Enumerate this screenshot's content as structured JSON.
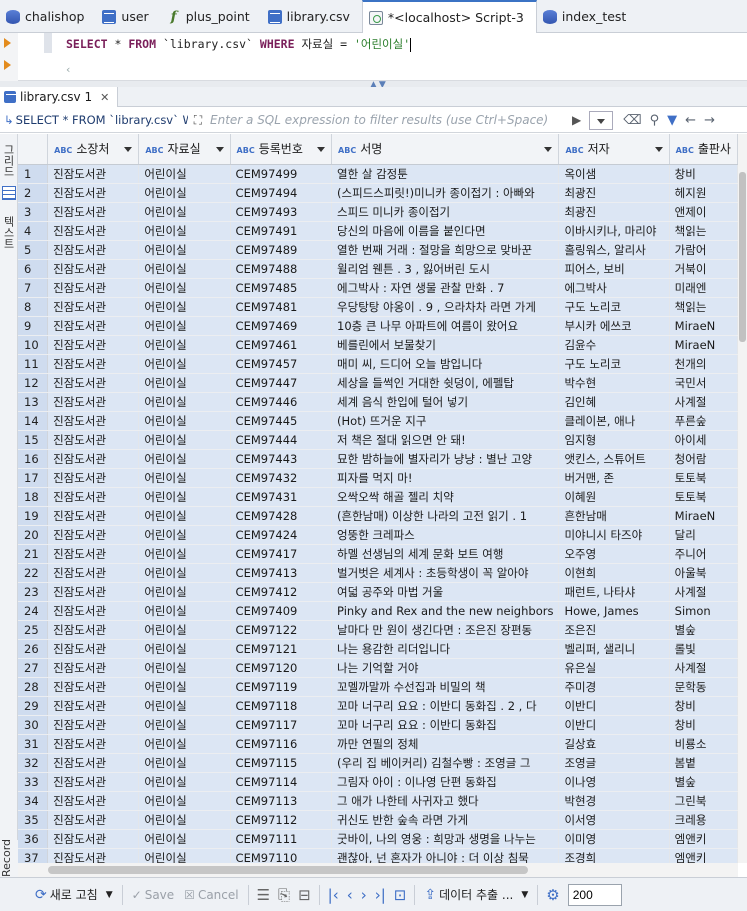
{
  "tabs": [
    {
      "label": "chalishop",
      "icon": "database-icon",
      "active": false
    },
    {
      "label": "user",
      "icon": "table-icon",
      "active": false
    },
    {
      "label": "plus_point",
      "icon": "function-icon",
      "active": false
    },
    {
      "label": "library.csv",
      "icon": "table-icon",
      "active": false
    },
    {
      "label": "*<localhost> Script-3",
      "icon": "script-icon",
      "active": true
    },
    {
      "label": "index_test",
      "icon": "database-icon",
      "active": false
    }
  ],
  "editor": {
    "kw_select": "SELECT",
    "star": " * ",
    "kw_from": "FROM",
    "table": " `library.csv` ",
    "kw_where": "WHERE",
    "column": " 자료실 = ",
    "value": "'어린이실'"
  },
  "results_tab": {
    "label": "library.csv 1",
    "close": "✕"
  },
  "filter": {
    "query": "SELECT * FROM `library.csv` WH",
    "placeholder": "Enter a SQL expression to filter results (use Ctrl+Space)"
  },
  "side": {
    "grid_label": "그리드",
    "text_label": "텍스트",
    "record_label": "Record"
  },
  "columns": [
    "소장처",
    "자료실",
    "등록번호",
    "서명",
    "저자",
    "출판사"
  ],
  "rows": [
    [
      "1",
      "진잠도서관",
      "어린이실",
      "CEM97499",
      "열한 살 감정툰",
      "옥이샘",
      "창비"
    ],
    [
      "2",
      "진잠도서관",
      "어린이실",
      "CEM97494",
      "(스피드스피릿!)미니카 종이접기 : 아빠와",
      "최광진",
      "헤지원"
    ],
    [
      "3",
      "진잠도서관",
      "어린이실",
      "CEM97493",
      "스피드 미니카 종이접기",
      "최광진",
      "앤제이"
    ],
    [
      "4",
      "진잠도서관",
      "어린이실",
      "CEM97491",
      "당신의 마음에 이름을 붙인다면",
      "이바시키나, 마리야",
      "책읽는"
    ],
    [
      "5",
      "진잠도서관",
      "어린이실",
      "CEM97489",
      "열한 번째 거래 : 절망을 희망으로 맞바꾼",
      "홀링워스, 알리사",
      "가람어"
    ],
    [
      "6",
      "진잠도서관",
      "어린이실",
      "CEM97488",
      "윌리엄 웬튼 . 3 , 잃어버린 도시",
      "피어스, 보비",
      "거북이"
    ],
    [
      "7",
      "진잠도서관",
      "어린이실",
      "CEM97485",
      "에그박사 : 자연 생물 관찰 만화 . 7",
      "에그박사",
      "미래엔"
    ],
    [
      "8",
      "진잠도서관",
      "어린이실",
      "CEM97481",
      "우당탕탕 야옹이 . 9 , 으라차차 라면 가게",
      "구도 노리코",
      "책읽는"
    ],
    [
      "9",
      "진잠도서관",
      "어린이실",
      "CEM97469",
      "10층 큰 나무 아파트에 여름이 왔어요",
      "부시카 에쓰코",
      "MiraeN"
    ],
    [
      "10",
      "진잠도서관",
      "어린이실",
      "CEM97461",
      "베를린에서 보물찾기",
      "김윤수",
      "MiraeN"
    ],
    [
      "11",
      "진잠도서관",
      "어린이실",
      "CEM97457",
      "매미 씨, 드디어 오늘 밤입니다",
      "구도 노리코",
      "천개의"
    ],
    [
      "12",
      "진잠도서관",
      "어린이실",
      "CEM97447",
      "세상을 들썩인 거대한 쉿덩이, 에펠탑",
      "박수현",
      "국민서"
    ],
    [
      "13",
      "진잠도서관",
      "어린이실",
      "CEM97446",
      "세계 음식 한입에 털어 넣기",
      "김인혜",
      "사계절"
    ],
    [
      "14",
      "진잠도서관",
      "어린이실",
      "CEM97445",
      "(Hot) 뜨거운 지구",
      "클레이본, 애나",
      "푸른숲"
    ],
    [
      "15",
      "진잠도서관",
      "어린이실",
      "CEM97444",
      "저 책은 절대 읽으면 안 돼!",
      "임지형",
      "아이세"
    ],
    [
      "16",
      "진잠도서관",
      "어린이실",
      "CEM97443",
      "묘한 밤하늘에 별자리가 냥냥 : 별난 고양",
      "앳킨스, 스튜어트",
      "청어람"
    ],
    [
      "17",
      "진잠도서관",
      "어린이실",
      "CEM97432",
      "피자를 먹지 마!",
      "버거맨, 존",
      "토토북"
    ],
    [
      "18",
      "진잠도서관",
      "어린이실",
      "CEM97431",
      "오싹오싹 해골 젤리 치약",
      "이혜원",
      "토토북"
    ],
    [
      "19",
      "진잠도서관",
      "어린이실",
      "CEM97428",
      "(흔한남매) 이상한 나라의 고전 읽기 . 1",
      "흔한남매",
      "MiraeN"
    ],
    [
      "20",
      "진잠도서관",
      "어린이실",
      "CEM97424",
      "엉뚱한 크레파스",
      "미야니시 타즈야",
      "달리"
    ],
    [
      "21",
      "진잠도서관",
      "어린이실",
      "CEM97417",
      "하멜 선생님의 세계 문화 보트 여행",
      "오주영",
      "주니어"
    ],
    [
      "22",
      "진잠도서관",
      "어린이실",
      "CEM97413",
      "벌거벗은 세계사 : 초등학생이 꼭 알아야",
      "이현희",
      "아울북"
    ],
    [
      "23",
      "진잠도서관",
      "어린이실",
      "CEM97412",
      "여덟 공주와 마법 거울",
      "패런트, 나타샤",
      "사계절"
    ],
    [
      "24",
      "진잠도서관",
      "어린이실",
      "CEM97409",
      "Pinky and Rex and the new neighbors",
      "Howe, James",
      "Simon"
    ],
    [
      "25",
      "진잠도서관",
      "어린이실",
      "CEM97122",
      "날마다 만 원이 생긴다면 : 조은진 장편동",
      "조은진",
      "별숲"
    ],
    [
      "26",
      "진잠도서관",
      "어린이실",
      "CEM97121",
      "나는 용감한 리더입니다",
      "벨리퍼, 샐리니",
      "롤빛"
    ],
    [
      "27",
      "진잠도서관",
      "어린이실",
      "CEM97120",
      "나는 기억할 거야",
      "유은실",
      "사계절"
    ],
    [
      "28",
      "진잠도서관",
      "어린이실",
      "CEM97119",
      "꼬멜까말까 수선집과 비밀의 책",
      "주미경",
      "문학동"
    ],
    [
      "29",
      "진잠도서관",
      "어린이실",
      "CEM97118",
      "꼬마 너구리 요요 : 이반디 동화집 . 2 , 다",
      "이반디",
      "창비"
    ],
    [
      "30",
      "진잠도서관",
      "어린이실",
      "CEM97117",
      "꼬마 너구리 요요 : 이반디 동화집",
      "이반디",
      "창비"
    ],
    [
      "31",
      "진잠도서관",
      "어린이실",
      "CEM97116",
      "까만 연필의 정체",
      "길상효",
      "비룡소"
    ],
    [
      "32",
      "진잠도서관",
      "어린이실",
      "CEM97115",
      "(우리 집 베이커리) 김철수빵 : 조영글 그",
      "조영글",
      "봄볕"
    ],
    [
      "33",
      "진잠도서관",
      "어린이실",
      "CEM97114",
      "그림자 아이 : 이나영 단편 동화집",
      "이나영",
      "별숲"
    ],
    [
      "34",
      "진잠도서관",
      "어린이실",
      "CEM97113",
      "그 애가 나한테 사귀자고 했다",
      "박현경",
      "그린북"
    ],
    [
      "35",
      "진잠도서관",
      "어린이실",
      "CEM97112",
      "귀신도 반한 숲속 라면 가게",
      "이서영",
      "크레용"
    ],
    [
      "36",
      "진잠도서관",
      "어린이실",
      "CEM97111",
      "굿바이, 나의 영웅 : 희망과 생명을 나누는",
      "이미영",
      "엠앤키"
    ],
    [
      "37",
      "진잠도서관",
      "어린이실",
      "CEM97110",
      "괜찮아, 넌 혼자가 아니야 : 더 이상 침묵",
      "조경희",
      "엠앤키"
    ]
  ],
  "bottom": {
    "refresh_label": "새로 고침",
    "save_label": "Save",
    "cancel_label": "Cancel",
    "export_label": "데이터 추출 ...",
    "fetch_size": "200"
  },
  "colors": {
    "accent": "#3f6fc6",
    "selected_row": "#dce6f4",
    "sql_keyword": "#7a1f5a",
    "sql_string": "#2a7d2a"
  }
}
